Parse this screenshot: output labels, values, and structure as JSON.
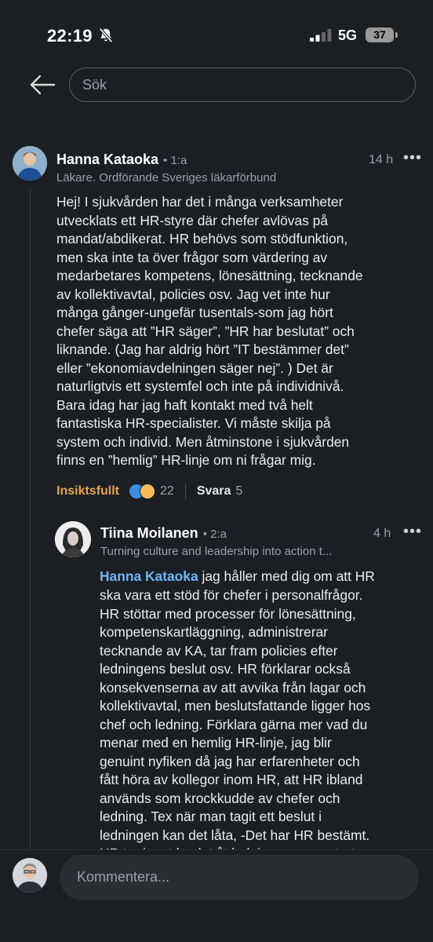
{
  "status_bar": {
    "time": "22:19",
    "network": "5G",
    "battery": "37"
  },
  "header": {
    "search_placeholder": "Sök"
  },
  "comment": {
    "author": "Hanna Kataoka",
    "degree": "• 1:a",
    "headline": "Läkare. Ordförande Sveriges läkarförbund",
    "time": "14 h",
    "text": "Hej! I sjukvården har det i många verksamheter\nutvecklats ett HR-styre där chefer avlövas på\nmandat/abdikerat. HR behövs som stödfunktion,\nmen ska inte ta över frågor som värdering av\nmedarbetares kompetens, lönesättning, tecknande\nav kollektivavtal, policies osv. Jag vet inte hur\nmånga gånger-ungefär tusentals-som jag hört\nchefer säga att ”HR säger”, ”HR har beslutat” och\nliknande. (Jag har aldrig hört ”IT bestämmer det”\neller ”ekonomiavdelningen säger nej”. ) Det är\nnaturligtvis ett systemfel och inte på individnivå.\nBara idag har jag haft kontakt med två helt\nfantastiska HR-specialister. Vi måste skilja på\nsystem och individ. Men åtminstone i sjukvården\nfinns en ”hemlig” HR-linje om ni frågar mig.",
    "reaction_label": "Insiktsfullt",
    "reaction_count": "22",
    "reply_label": "Svara",
    "reply_count": "5"
  },
  "reply": {
    "author": "Tiina Moilanen",
    "degree": "• 2:a",
    "headline": "Turning culture and leadership into action t...",
    "time": "4 h",
    "mention": "Hanna Kataoka",
    "first_line_rest": " jag håller med dig om att HR",
    "text": "ska vara ett stöd för chefer i personalfrågor.\nHR stöttar med processer för lönesättning,\nkompetenskartläggning, administrerar\ntecknande av KA, tar fram policies efter\nledningens beslut osv. HR förklarar också\nkonsekvenserna av att avvika från lagar och\nkollektivavtal, men beslutsfattande ligger hos\nchef och ledning. Förklara gärna mer vad du\nmenar med en hemlig HR-linje, jag blir\ngenuint nyfiken då jag har erfarenheter och\nfått höra av kollegor inom HR, att HR ibland\nanvänds som krockkudde av chefer och\nledning. Tex när man tagit ett beslut i\nledningen kan det låta, -Det har HR bestämt.\nHR tar inget beslut åt ledningen, men stort"
  },
  "composer": {
    "placeholder": "Kommentera..."
  },
  "colors": {
    "accent_orange": "#e8a450",
    "mention_blue": "#70b5f9",
    "background": "#1b1f23"
  }
}
